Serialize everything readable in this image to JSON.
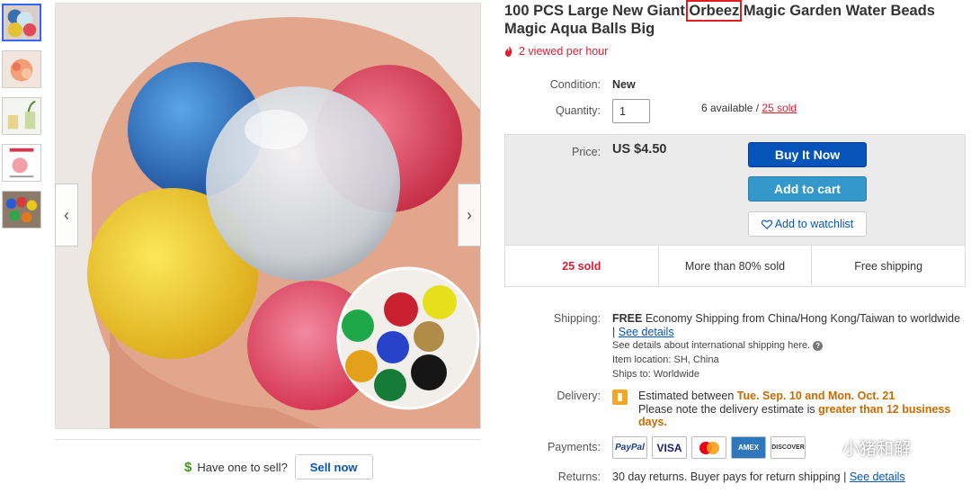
{
  "product": {
    "title_before": "100 PCS Large New Giant ",
    "title_highlight": "Orbeez",
    "title_after": " Magic Garden Water Beads Magic Aqua Balls Big",
    "viewed": "2 viewed per hour"
  },
  "condition": {
    "label": "Condition:",
    "value": "New"
  },
  "quantity": {
    "label": "Quantity:",
    "value": "1",
    "available": "6 available / ",
    "sold_link": "25 sold"
  },
  "price": {
    "label": "Price:",
    "value": "US $4.50"
  },
  "buttons": {
    "buy_now": "Buy It Now",
    "add_to_cart": "Add to cart",
    "watchlist": "Add to watchlist"
  },
  "stats": {
    "sold": "25 sold",
    "percent": "More than 80% sold",
    "shipping": "Free shipping"
  },
  "shipping": {
    "label": "Shipping:",
    "free": "FREE",
    "desc": "Economy Shipping from China/Hong Kong/Taiwan to worldwide",
    "sep": "|",
    "details": "See details",
    "intl": "See details about international shipping here.",
    "location": "Item location:  SH, China",
    "ships_to": "Ships to:  Worldwide"
  },
  "delivery": {
    "label": "Delivery:",
    "estimated": "Estimated between ",
    "date1": "Tue. Sep. 10",
    "and": " and ",
    "date2": "Mon. Oct. 21",
    "note": "Please note the delivery estimate is ",
    "note_highlight": "greater than 12 business days."
  },
  "payments": {
    "label": "Payments:",
    "cards": [
      "PayPal",
      "VISA",
      "MC",
      "AMEX",
      "DISCOVER"
    ]
  },
  "returns": {
    "label": "Returns:",
    "text": "30 day returns. Buyer pays for return shipping |",
    "link": "See details"
  },
  "sell": {
    "prompt": "Have one to sell?",
    "button": "Sell now",
    "dollar": "$"
  },
  "watermark": {
    "text": "小猪和解"
  },
  "icons": {
    "prev": "chevron-left-icon",
    "next": "chevron-right-icon",
    "heart": "heart-icon",
    "flame": "flame-icon"
  },
  "colors": {
    "buy_now": "#0654ba",
    "add_to_cart": "#3498ca",
    "sold_red": "#dd1e31",
    "delivery_orange": "#c96a00"
  }
}
